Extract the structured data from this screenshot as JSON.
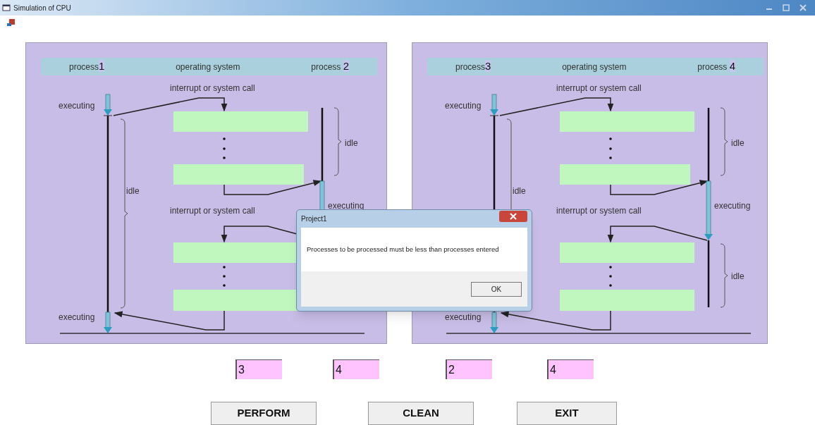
{
  "window": {
    "title": "Simulation of CPU"
  },
  "panels": [
    {
      "header": [
        {
          "label": "process",
          "number": "1"
        },
        {
          "label": "operating system"
        },
        {
          "label": "process ",
          "number": "2"
        }
      ],
      "labels": [
        {
          "kind": "call-top",
          "text": "interrupt or system call"
        },
        {
          "kind": "exec-top-left",
          "text": "executing"
        },
        {
          "kind": "idle-left",
          "text": "idle"
        },
        {
          "kind": "idle-right-top",
          "text": "idle"
        },
        {
          "kind": "exec-right",
          "text": "executing"
        },
        {
          "kind": "call-middle",
          "text": "interrupt or system call"
        },
        {
          "kind": "exec-bottom-left",
          "text": "executing"
        }
      ]
    },
    {
      "header": [
        {
          "label": "process",
          "number": "3"
        },
        {
          "label": "operating system"
        },
        {
          "label": "process ",
          "number": "4"
        }
      ],
      "labels": [
        {
          "kind": "call-top",
          "text": "interrupt or system call"
        },
        {
          "kind": "exec-top-left",
          "text": "executing"
        },
        {
          "kind": "idle-left",
          "text": "idle"
        },
        {
          "kind": "idle-right-top",
          "text": "idle"
        },
        {
          "kind": "exec-right",
          "text": "executing"
        },
        {
          "kind": "call-middle",
          "text": "interrupt or system call"
        },
        {
          "kind": "idle-right-bottom",
          "text": "idle"
        },
        {
          "kind": "exec-bottom-left",
          "text": "executing"
        }
      ]
    }
  ],
  "inputs": [
    "3",
    "4",
    "2",
    "4"
  ],
  "buttons": [
    "PERFORM",
    "CLEAN",
    "EXIT"
  ],
  "dialog": {
    "title": "Project1",
    "message": "Processes to be processed must be less than processes entered",
    "button": "OK"
  }
}
